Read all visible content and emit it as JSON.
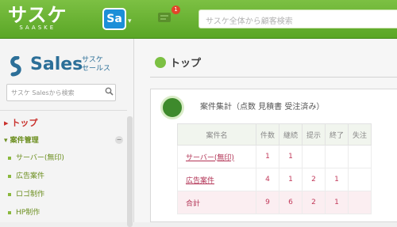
{
  "app": {
    "logo_text": "サスケ",
    "logo_sub": "SAASKE",
    "app_badge": "Sa",
    "notification_count": "1",
    "search_placeholder": "サスケ全体から顧客検索"
  },
  "sidebar": {
    "brand_title": "Sales",
    "brand_sub_1": "サスケ",
    "brand_sub_2": "セールス",
    "search_placeholder": "サスケ Salesから検索",
    "top_label": "▸ トップ",
    "section_label": "▾ 案件管理",
    "items": [
      {
        "label": "サーバー(無印)"
      },
      {
        "label": "広告案件"
      },
      {
        "label": "ロゴ制作"
      },
      {
        "label": "HP制作"
      }
    ]
  },
  "main": {
    "page_title": "トップ",
    "panel_title": "案件集計（点数 見積書 受注済み）",
    "table": {
      "headers": [
        "案件名",
        "件数",
        "継続",
        "提示",
        "終了",
        "失注"
      ],
      "rows": [
        {
          "name": "サーバー(無印)",
          "values": [
            "1",
            "1",
            "",
            "",
            ""
          ]
        },
        {
          "name": "広告案件",
          "values": [
            "4",
            "1",
            "2",
            "1",
            ""
          ]
        },
        {
          "name": "合計",
          "values": [
            "9",
            "6",
            "2",
            "1",
            ""
          ]
        }
      ]
    }
  }
}
